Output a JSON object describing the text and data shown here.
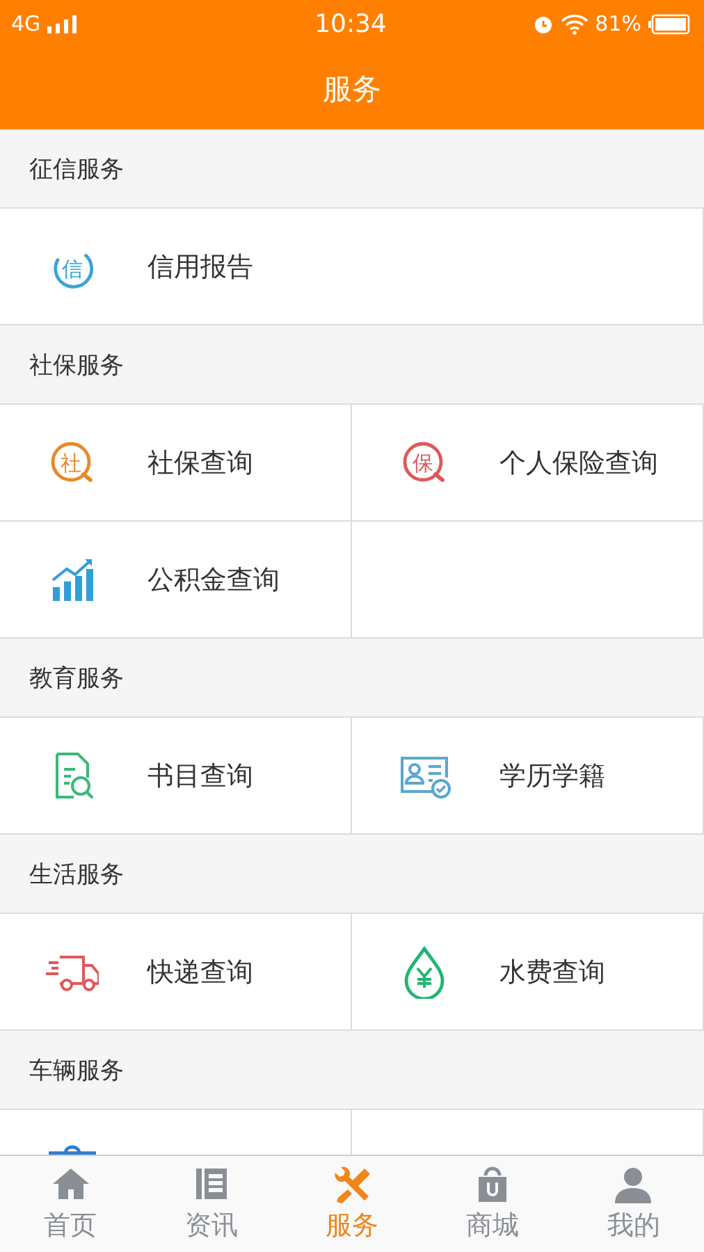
{
  "status_bar": {
    "network": "4G",
    "time": "10:34",
    "battery": "81%"
  },
  "header": {
    "title": "服务"
  },
  "sections": [
    {
      "title": "征信服务",
      "kind": "list",
      "items": [
        {
          "kind": "glyph",
          "glyph": "信",
          "label": "信用报告"
        }
      ]
    },
    {
      "title": "社保服务",
      "kind": "grid",
      "items": [
        {
          "kind": "glyph-search",
          "glyph": "社",
          "label": "社保查询"
        },
        {
          "kind": "glyph-search",
          "glyph": "保",
          "label": "个人保险查询"
        },
        {
          "kind": "chart",
          "label": "公积金查询"
        }
      ]
    },
    {
      "title": "教育服务",
      "kind": "grid",
      "items": [
        {
          "kind": "document",
          "label": "书目查询"
        },
        {
          "kind": "card",
          "label": "学历学籍"
        }
      ]
    },
    {
      "title": "生活服务",
      "kind": "grid",
      "items": [
        {
          "kind": "truck",
          "label": "快递查询"
        },
        {
          "kind": "drop",
          "label": "水费查询"
        }
      ]
    },
    {
      "title": "车辆服务",
      "kind": "grid",
      "items": [
        {
          "kind": "vehicle"
        }
      ]
    }
  ],
  "tabs": [
    {
      "kind": "home",
      "label": "首页",
      "selected": false
    },
    {
      "kind": "news",
      "label": "资讯",
      "selected": false
    },
    {
      "kind": "tools",
      "label": "服务",
      "selected": true
    },
    {
      "kind": "bag",
      "label": "商城",
      "selected": false
    },
    {
      "kind": "person",
      "label": "我的",
      "selected": false
    }
  ]
}
